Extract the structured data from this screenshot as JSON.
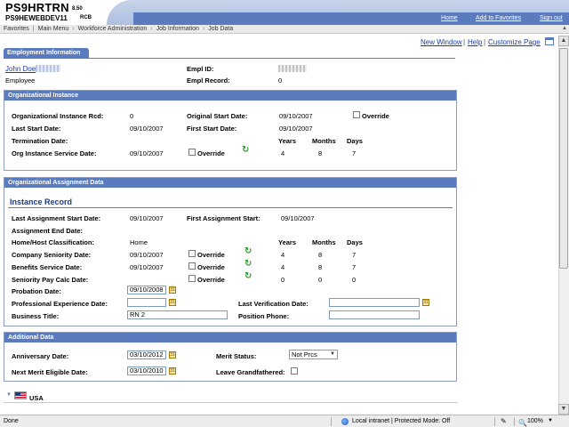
{
  "header": {
    "app_title": "PS9HRTRN",
    "app_version": "8.50",
    "db_name": "PS9HEWEBDEV11",
    "db_suffix": "RCB",
    "links": {
      "home": "Home",
      "favorites": "Add to Favorites",
      "signout": "Sign out"
    },
    "colors": {
      "band": "#5b7bbf",
      "swoosh": "#b9c9e6"
    }
  },
  "breadcrumb": [
    "Favorites",
    "Main Menu",
    "Workforce Administration",
    "Job Information",
    "Job Data"
  ],
  "page_links": {
    "new_window": "New Window",
    "help": "Help",
    "customize": "Customize Page",
    "grid_icon": "grid-view-icon"
  },
  "tab": {
    "label": "Employment Information"
  },
  "employee": {
    "name": "John Doe",
    "type": "Employee",
    "empl_id_label": "Empl ID:",
    "empl_record_label": "Empl Record:",
    "empl_record": "0"
  },
  "org_instance": {
    "title": "Organizational Instance",
    "rcd_label": "Organizational Instance Rcd:",
    "rcd": "0",
    "orig_start_label": "Original Start Date:",
    "orig_start": "09/10/2007",
    "override_label": "Override",
    "last_start_label": "Last Start Date:",
    "last_start": "09/10/2007",
    "first_start_label": "First Start Date:",
    "first_start": "09/10/2007",
    "termination_label": "Termination Date:",
    "years_label": "Years",
    "months_label": "Months",
    "days_label": "Days",
    "service_label": "Org Instance Service Date:",
    "service_date": "09/10/2007",
    "years": "4",
    "months": "8",
    "days": "7"
  },
  "org_assignment": {
    "title": "Organizational Assignment Data",
    "instance_record_title": "Instance Record",
    "last_assign_label": "Last Assignment Start Date:",
    "last_assign": "09/10/2007",
    "first_assign_label": "First Assignment Start:",
    "first_assign": "09/10/2007",
    "assign_end_label": "Assignment End Date:",
    "classification_label": "Home/Host Classification:",
    "classification": "Home",
    "years_label": "Years",
    "months_label": "Months",
    "days_label": "Days",
    "override_label": "Override",
    "company_seniority_label": "Company Seniority Date:",
    "company_seniority": "09/10/2007",
    "cs_years": "4",
    "cs_months": "8",
    "cs_days": "7",
    "benefits_label": "Benefits Service Date:",
    "benefits": "09/10/2007",
    "bs_years": "4",
    "bs_months": "8",
    "bs_days": "7",
    "seniority_calc_label": "Seniority Pay Calc Date:",
    "sp_years": "0",
    "sp_months": "0",
    "sp_days": "0",
    "probation_label": "Probation Date:",
    "probation": "09/10/2008",
    "prof_exp_label": "Professional Experience Date:",
    "prof_exp": "",
    "last_verif_label": "Last Verification Date:",
    "last_verif": "",
    "business_title_label": "Business Title:",
    "business_title": "RN 2",
    "position_phone_label": "Position Phone:",
    "position_phone": ""
  },
  "additional": {
    "title": "Additional Data",
    "anniversary_label": "Anniversary Date:",
    "anniversary": "03/10/2012",
    "merit_status_label": "Merit Status:",
    "merit_status": "Not Prcs",
    "next_merit_label": "Next Merit Eligible Date:",
    "next_merit": "03/10/2010",
    "leave_gf_label": "Leave Grandfathered:"
  },
  "country": {
    "label": "USA",
    "flag_icon": "us-flag-icon",
    "expand_icon": "expand-triangle-icon"
  },
  "statusbar": {
    "status": "Done",
    "zone": "Local intranet | Protected Mode: Off",
    "zoom": "100%"
  }
}
